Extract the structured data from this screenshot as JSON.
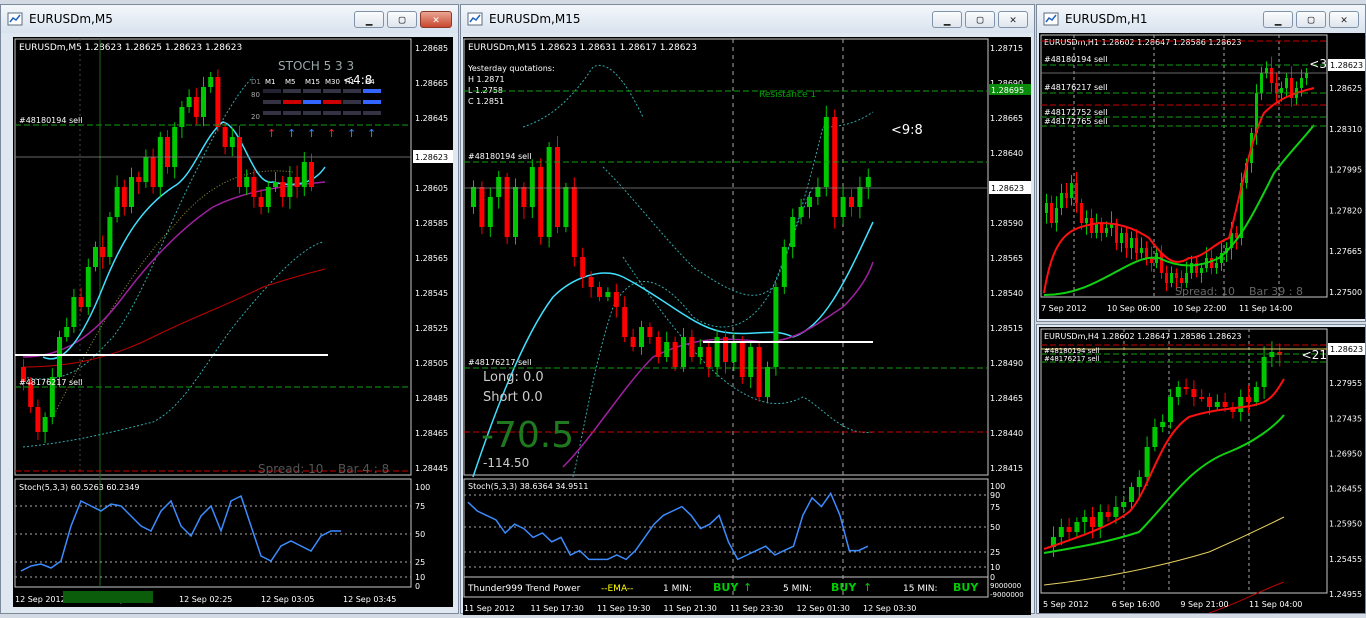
{
  "windows": {
    "m5": {
      "title": "EURUSDm,M5",
      "header": "EURUSDm,M5  1.28623 1.28625 1.28623 1.28623",
      "prices": [
        "1.28685",
        "1.28665",
        "1.28645",
        "1.28625",
        "1.28605",
        "1.28585",
        "1.28565",
        "1.28545",
        "1.28525",
        "1.28505",
        "1.28485",
        "1.28465",
        "1.28445"
      ],
      "current_price": "1.28623",
      "order_lines": [
        "#48180194 sell",
        "#48176217 sell"
      ],
      "spread": "Spread: 10",
      "bar": "Bar  4 : 8",
      "countdown": "<4:8",
      "stoch_panel": {
        "title": "STOCH  5 3 3",
        "tf": [
          "M1",
          "M5",
          "M15",
          "M30",
          "H1",
          "H4"
        ],
        "levels": [
          "80",
          "20"
        ],
        "d_label": "D1"
      },
      "sub_label": "Stoch(5,3,3) 60.5263 60.2349",
      "sub_scale": [
        "100",
        "75",
        "50",
        "25",
        "10",
        "0"
      ],
      "times": [
        "12 Sep 2012",
        "12 Sep 01:45",
        "12 Sep 02:25",
        "12 Sep 03:05",
        "12 Sep 03:45"
      ]
    },
    "m15": {
      "title": "EURUSDm,M15",
      "header": "EURUSDm,M15  1.28623 1.28631 1.28617 1.28623",
      "yesterday": [
        "Yesterday quotations:",
        "H 1.2871",
        "L 1.2758",
        "C 1.2851"
      ],
      "prices": [
        "1.28715",
        "1.28690",
        "1.28665",
        "1.28640",
        "1.28615",
        "1.28590",
        "1.28565",
        "1.28540",
        "1.28515",
        "1.28490",
        "1.28465",
        "1.28440",
        "1.28415"
      ],
      "current_price": "1.28623",
      "resistance_price": "1.28695",
      "resistance_label": "Resistance 1",
      "countdown": "<9:8",
      "order_lines": [
        "#48180194 sell",
        "#48176217 sell"
      ],
      "long": "Long:  0.0",
      "short": "Short  0.0",
      "big_value": "-70.5",
      "small_value": "-114.50",
      "sub_label": "Stoch(5,3,3) 38.6364 34.9511",
      "sub_scale": [
        "100",
        "90",
        "75",
        "50",
        "25",
        "10",
        "0"
      ],
      "bottom_bar": {
        "name": "Thunder999 Trend Power",
        "ema": "--EMA--",
        "items": [
          {
            "label": "1 MIN:",
            "signal": "BUY"
          },
          {
            "label": "5 MIN:",
            "signal": "BUY"
          },
          {
            "label": "15 MIN:",
            "signal": "BUY"
          }
        ],
        "scale_top": "9000000",
        "scale_bottom": "-9000000"
      },
      "times": [
        "11 Sep 2012",
        "11 Sep 17:30",
        "11 Sep 19:30",
        "11 Sep 21:30",
        "11 Sep 23:30",
        "12 Sep 01:30",
        "12 Sep 03:30"
      ]
    },
    "h1": {
      "title": "EURUSDm,H1",
      "header": "EURUSDm,H1  1.28602 1.28647 1.28586 1.28623",
      "prices": [
        "1.28625",
        "1.28310",
        "1.27995",
        "1.27820",
        "1.27665",
        "1.27500"
      ],
      "current_price": "1.28623",
      "countdown": "<3",
      "order_lines": [
        "#48180194 sell",
        "#48176217 sell",
        "#48172752 sell",
        "#48172765 sell"
      ],
      "spread": "Spread: 10",
      "bar": "Bar  39 : 8",
      "times": [
        "7 Sep 2012",
        "10 Sep 06:00",
        "10 Sep 22:00",
        "11 Sep 14:00"
      ]
    },
    "h4": {
      "header": "EURUSDm,H4  1.28602 1.28647 1.28586 1.28623",
      "prices": [
        "1.28623",
        "1.27955",
        "1.27435",
        "1.26950",
        "1.26455",
        "1.25950",
        "1.25455",
        "1.24955"
      ],
      "current_price": "1.28623",
      "countdown": "<21",
      "order_lines": [
        "#48180194 sell",
        "#48176217 sell"
      ],
      "times": [
        "5 Sep 2012",
        "6 Sep 16:00",
        "9 Sep 21:00",
        "11 Sep 04:00"
      ]
    }
  },
  "colors": {
    "bull": "#00c800",
    "bear": "#ff0000",
    "ma_fast": "#40e0ff",
    "ma_mid": "#a020a0",
    "ma_slow": "#c00000",
    "order": "#10a010",
    "stoch": "#3c8cff",
    "h1_mid": "#ff1010",
    "h1_slow": "#10d010"
  }
}
